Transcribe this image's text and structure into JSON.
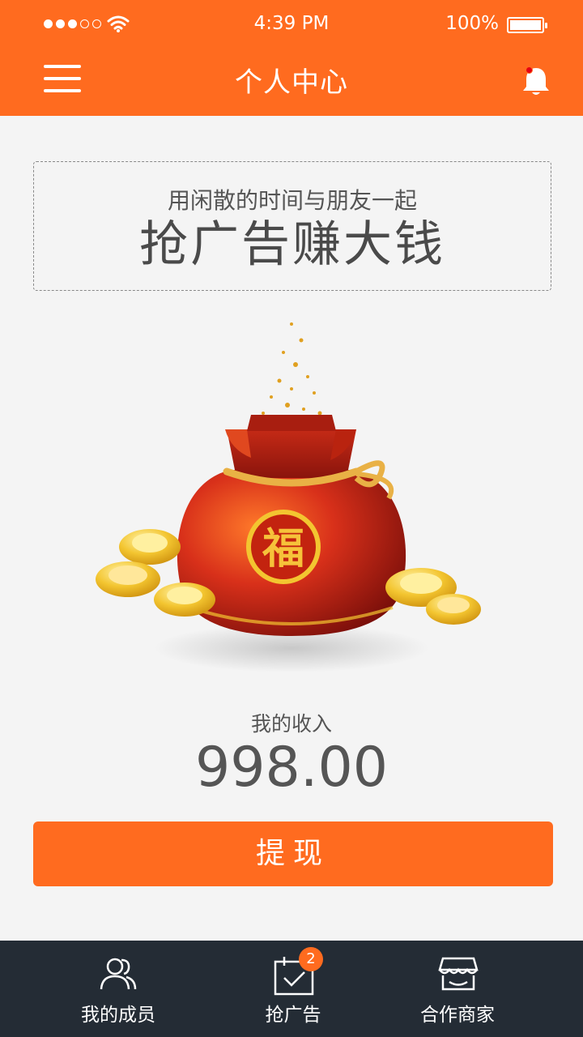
{
  "status_bar": {
    "time": "4:39 PM",
    "battery": "100%"
  },
  "header": {
    "title": "个人中心"
  },
  "slogan": {
    "line1": "用闲散的时间与朋友一起",
    "line2": "抢广告赚大钱"
  },
  "fortune_bag": {
    "character": "福"
  },
  "income": {
    "label": "我的收入",
    "value": "998.00"
  },
  "withdraw": {
    "label": "提现"
  },
  "tabbar": {
    "items": [
      {
        "label": "我的成员",
        "icon": "members-icon"
      },
      {
        "label": "抢广告",
        "icon": "calendar-check-icon",
        "badge": "2"
      },
      {
        "label": "合作商家",
        "icon": "shop-icon"
      }
    ]
  },
  "colors": {
    "accent": "#ff6b1f",
    "tabbar_bg": "#242c35",
    "background": "#f4f4f4"
  }
}
